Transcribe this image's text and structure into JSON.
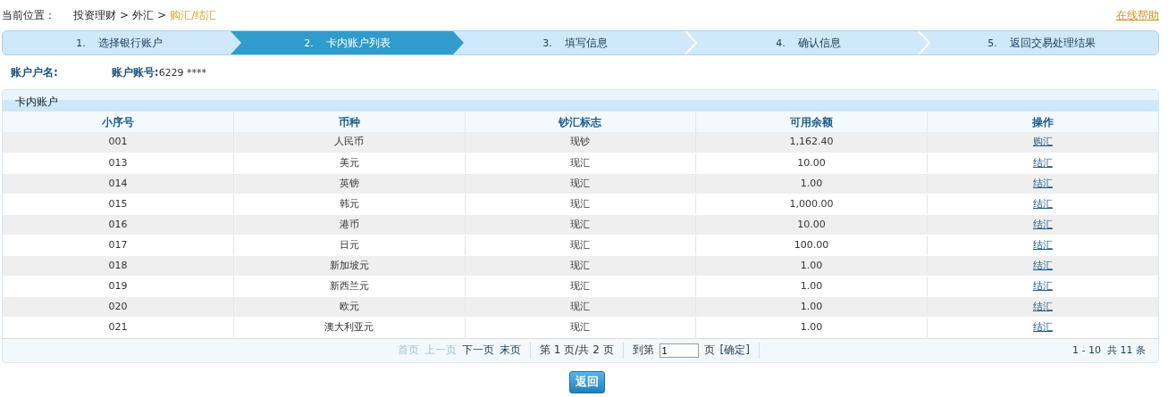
{
  "breadcrumb": {
    "label": "当前位置：",
    "path": [
      {
        "text": "投资理财",
        "current": false
      },
      {
        "text": "外汇",
        "current": false
      },
      {
        "text": "购汇/结汇",
        "current": true
      }
    ],
    "separator": ">"
  },
  "help_link": "在线帮助",
  "steps": [
    {
      "number": "1.",
      "label": "选择银行账户",
      "selected": false
    },
    {
      "number": "2.",
      "label": "卡内账户列表",
      "selected": true
    },
    {
      "number": "3.",
      "label": "填写信息",
      "selected": false
    },
    {
      "number": "4.",
      "label": "确认信息",
      "selected": false
    },
    {
      "number": "5.",
      "label": "返回交易处理结果",
      "selected": false
    }
  ],
  "account": {
    "name_label": "账户户名:",
    "number_label": "账户账号:",
    "number_value": "6229 ****"
  },
  "panel": {
    "title": "卡内账户",
    "table": {
      "columns": [
        "小序号",
        "币种",
        "钞汇标志",
        "可用余额",
        "操作"
      ],
      "rows": [
        {
          "cells": [
            "001",
            "人民币",
            "现钞",
            "1,162.40"
          ],
          "action": "购汇"
        },
        {
          "cells": [
            "013",
            "美元",
            "现汇",
            "10.00"
          ],
          "action": "结汇"
        },
        {
          "cells": [
            "014",
            "英镑",
            "现汇",
            "1.00"
          ],
          "action": "结汇"
        },
        {
          "cells": [
            "015",
            "韩元",
            "现汇",
            "1,000.00"
          ],
          "action": "结汇"
        },
        {
          "cells": [
            "016",
            "港币",
            "现汇",
            "10.00"
          ],
          "action": "结汇"
        },
        {
          "cells": [
            "017",
            "日元",
            "现汇",
            "100.00"
          ],
          "action": "结汇"
        },
        {
          "cells": [
            "018",
            "新加坡元",
            "现汇",
            "1.00"
          ],
          "action": "结汇"
        },
        {
          "cells": [
            "019",
            "新西兰元",
            "现汇",
            "1.00"
          ],
          "action": "结汇"
        },
        {
          "cells": [
            "020",
            "欧元",
            "现汇",
            "1.00"
          ],
          "action": "结汇"
        },
        {
          "cells": [
            "021",
            "澳大利亚元",
            "现汇",
            "1.00"
          ],
          "action": "结汇"
        }
      ]
    },
    "pager": {
      "links": [
        {
          "text": "首页",
          "disabled": true
        },
        {
          "text": "上一页",
          "disabled": true
        },
        {
          "text": "下一页",
          "disabled": false
        },
        {
          "text": "末页",
          "disabled": false
        }
      ],
      "page_info": "第 1 页/共 2 页",
      "goto_label": "到第",
      "goto_value": "1",
      "goto_suffix": "页",
      "confirm": "[确定]",
      "summary": "1 - 10  共 11 条"
    }
  },
  "back_button": "返回"
}
